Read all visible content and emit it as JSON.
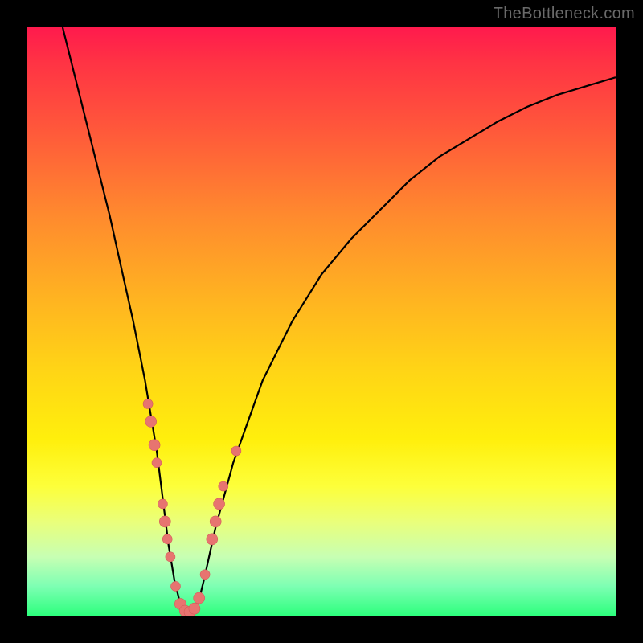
{
  "watermark": "TheBottleneck.com",
  "colors": {
    "dot_fill": "#e77470",
    "dot_stroke": "#d45d59",
    "curve": "#000000"
  },
  "chart_data": {
    "type": "line",
    "title": "",
    "xlabel": "",
    "ylabel": "",
    "xlim": [
      0,
      100
    ],
    "ylim": [
      0,
      100
    ],
    "grid": false,
    "legend": false,
    "series": [
      {
        "name": "bottleneck-curve",
        "x": [
          6,
          8,
          10,
          12,
          14,
          16,
          18,
          20,
          21,
          22,
          23,
          24,
          25,
          26,
          27,
          28,
          29,
          30,
          32,
          35,
          40,
          45,
          50,
          55,
          60,
          65,
          70,
          75,
          80,
          85,
          90,
          95,
          100
        ],
        "y": [
          100,
          92,
          84,
          76,
          68,
          59,
          50,
          40,
          34,
          28,
          20,
          12,
          6,
          2,
          0,
          0,
          2,
          6,
          15,
          26,
          40,
          50,
          58,
          64,
          69,
          74,
          78,
          81,
          84,
          86.5,
          88.5,
          90,
          91.5
        ]
      }
    ],
    "points": [
      {
        "x": 20.5,
        "y": 36,
        "r": 6
      },
      {
        "x": 21.0,
        "y": 33,
        "r": 7
      },
      {
        "x": 21.6,
        "y": 29,
        "r": 7
      },
      {
        "x": 22.0,
        "y": 26,
        "r": 6
      },
      {
        "x": 23.0,
        "y": 19,
        "r": 6
      },
      {
        "x": 23.4,
        "y": 16,
        "r": 7
      },
      {
        "x": 23.8,
        "y": 13,
        "r": 6
      },
      {
        "x": 24.3,
        "y": 10,
        "r": 6
      },
      {
        "x": 25.2,
        "y": 5,
        "r": 6
      },
      {
        "x": 26.0,
        "y": 2,
        "r": 7
      },
      {
        "x": 26.8,
        "y": 0.8,
        "r": 7
      },
      {
        "x": 27.6,
        "y": 0.6,
        "r": 7
      },
      {
        "x": 28.4,
        "y": 1.2,
        "r": 7
      },
      {
        "x": 29.2,
        "y": 3,
        "r": 7
      },
      {
        "x": 30.2,
        "y": 7,
        "r": 6
      },
      {
        "x": 31.4,
        "y": 13,
        "r": 7
      },
      {
        "x": 32.0,
        "y": 16,
        "r": 7
      },
      {
        "x": 32.6,
        "y": 19,
        "r": 7
      },
      {
        "x": 33.3,
        "y": 22,
        "r": 6
      },
      {
        "x": 35.5,
        "y": 28,
        "r": 6
      }
    ]
  }
}
